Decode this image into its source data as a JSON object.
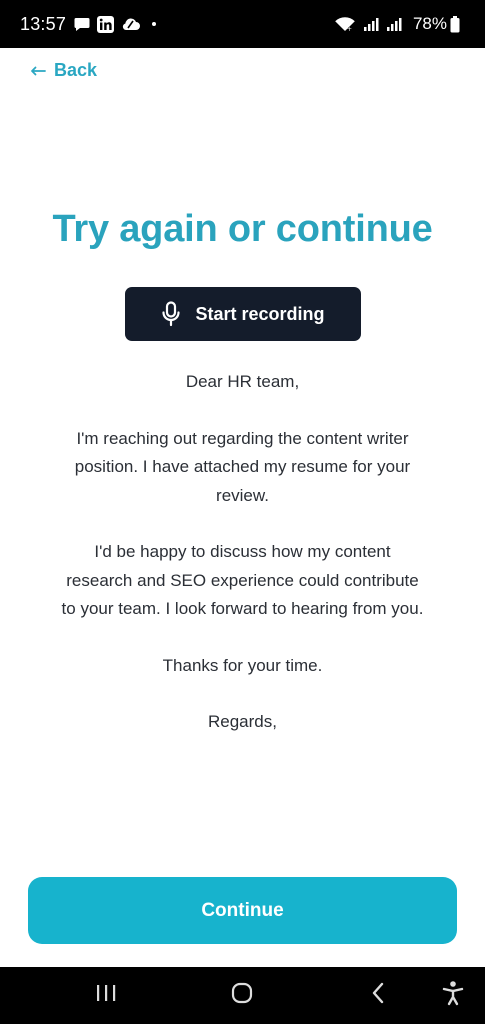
{
  "status_bar": {
    "time": "13:57",
    "icons_left": [
      "chat-bubble-icon",
      "linkedin-icon",
      "cloud-icon"
    ],
    "icons_right": [
      "wifi-icon",
      "signal-icon",
      "signal-icon",
      "battery-icon"
    ],
    "battery": "78%"
  },
  "nav": {
    "back_label": "Back"
  },
  "title": "Try again or continue",
  "record_button": {
    "label": "Start recording",
    "icon": "microphone-icon"
  },
  "letter": {
    "greeting": "Dear HR team,",
    "paragraph_1": "I'm reaching out regarding the content writer position. I have attached my resume for your review.",
    "paragraph_2": "I'd be happy to discuss how my content research and SEO experience could contribute to your team. I look forward to hearing from you.",
    "thanks": "Thanks for your time.",
    "signoff": "Regards,"
  },
  "continue_button": {
    "label": "Continue"
  },
  "colors": {
    "accent": "#2aa3bd",
    "button_dark": "#141c2b",
    "continue": "#17b3cd"
  },
  "system_nav": [
    "recents-icon",
    "home-icon",
    "back-icon",
    "accessibility-icon"
  ]
}
